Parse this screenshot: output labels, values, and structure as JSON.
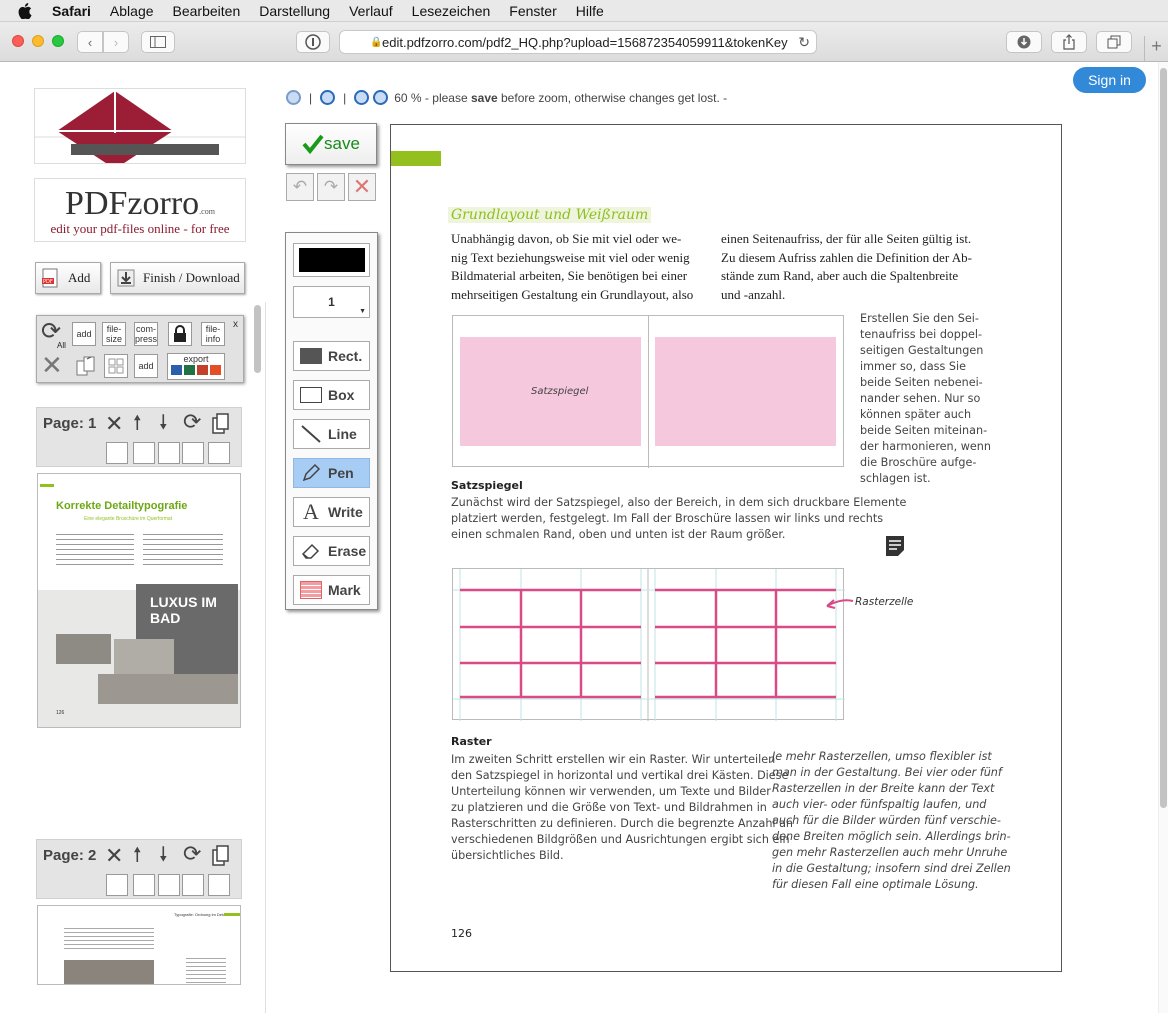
{
  "menubar": {
    "app": "Safari",
    "items": [
      "Ablage",
      "Bearbeiten",
      "Darstellung",
      "Verlauf",
      "Lesezeichen",
      "Fenster",
      "Hilfe"
    ]
  },
  "browser": {
    "url": "edit.pdfzorro.com/pdf2_HQ.php?upload=156872354059911&tokenKey",
    "sign_in": "Sign in"
  },
  "sidebar": {
    "logo_brand": "PDFzorro",
    "logo_com": ".com",
    "logo_tagline": "edit your pdf-files online - for free",
    "add_label": "Add",
    "finish_label": "Finish / Download",
    "tools": {
      "all": "All",
      "add": "add",
      "filesize": "file-size",
      "compress": "com-press",
      "fileinfo": "file-info",
      "add2": "add",
      "export": "export",
      "close": "x"
    },
    "pages": [
      {
        "label": "Page: 1"
      },
      {
        "label": "Page: 2"
      }
    ],
    "thumb1": {
      "title": "Korrekte Detailtypografie",
      "subtitle": "Eine elegante Broschüre im Querformat",
      "photo_text": "LUXUS IM BAD",
      "page_num": "126"
    },
    "thumb2": {
      "header": "Typografie: Ordnung im Detail"
    }
  },
  "zoom": {
    "text_prefix": "60 % - please ",
    "text_bold": "save",
    "text_suffix": " before zoom, otherwise changes get lost. -"
  },
  "editor": {
    "save_label": "save",
    "stroke_width": "1",
    "tools": [
      "Rect.",
      "Box",
      "Line",
      "Pen",
      "Write",
      "Erase",
      "Mark"
    ],
    "active_tool": "Pen",
    "color": "#000000"
  },
  "pdf": {
    "heading": "Grundlayout und Weißraum",
    "col1": "Unabhängig davon, ob Sie mit viel oder we-\nnig Text beziehungsweise mit viel oder wenig\nBildmaterial arbeiten, Sie benötigen bei einer\nmehrseitigen Gestaltung ein Grundlayout, also",
    "col2": "einen Seitenaufriss, der für alle Seiten gültig ist.\nZu diesem Aufriss zahlen die Definition der Ab-\nstände zum Rand, aber auch die Spaltenbreite\nund -anzahl.",
    "satzspiegel_label": "Satzspiegel",
    "side_note": "Erstellen Sie den Sei-\ntenaufriss bei doppel-\nseitigen Gestaltungen\nimmer so, dass Sie\nbeide Seiten nebenei-\nnander sehen. Nur so\nkönnen später auch\nbeide Seiten miteinan-\nder harmonieren, wenn\ndie Broschüre aufge-\nschlagen ist.",
    "satz_heading": "Satzspiegel",
    "satz_text": "Zunächst wird der Satzspiegel, also der Bereich, in dem sich druckbare Elemente\nplatziert werden, festgelegt. Im Fall der Broschüre lassen wir links und rechts\neinen schmalen Rand, oben und unten ist der Raum größer.",
    "raster_annot": "Rasterzelle",
    "raster_heading": "Raster",
    "raster_text": "Im zweiten Schritt erstellen wir ein Raster. Wir unterteilen\nden Satzspiegel in horizontal und vertikal drei Kästen. Diese\nUnterteilung können wir verwenden, um Texte und Bilder\nzu platzieren und die Größe von Text- und Bildrahmen in\nRasterschritten zu definieren. Durch die begrenzte Anzahl an\nverschiedenen Bildgrößen und Ausrichtungen ergibt sich ein\nübersichtliches Bild.",
    "raster_note": "Je mehr Rasterzellen, umso flexibler ist\nman in der Gestaltung. Bei vier oder fünf\nRasterzellen in der Breite kann der Text\nauch vier- oder fünfspaltig laufen, und\nauch für die Bilder würden fünf verschie-\ndene Breiten möglich sein. Allerdings brin-\ngen mehr Rasterzellen auch mehr Unruhe\nin die Gestaltung; insofern sind drei Zellen\nfür diesen Fall eine optimale Lösung.",
    "page_number": "126"
  },
  "colors": {
    "accent_green": "#93c01f",
    "pink": "#f6c8dd",
    "grid_pink": "#d94a86",
    "signin_blue": "#3189d8",
    "brand_red": "#8b1a2f"
  }
}
